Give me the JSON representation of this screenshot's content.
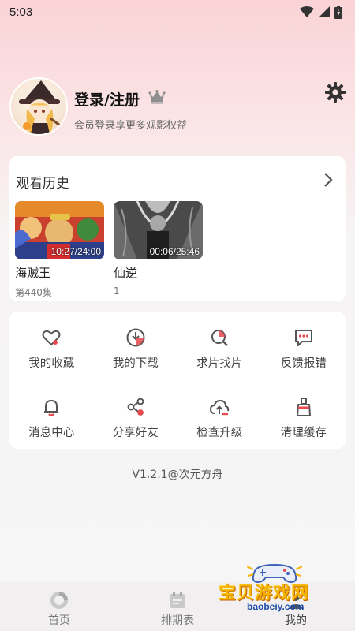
{
  "status_bar": {
    "time": "5:03"
  },
  "profile": {
    "username": "登录/注册",
    "subtitle": "会员登录享更多观影权益"
  },
  "history": {
    "title": "观看历史",
    "items": [
      {
        "name": "海贼王",
        "episode": "第440集",
        "time": "10:27/24:00"
      },
      {
        "name": "仙逆",
        "episode": "1",
        "time": "00:06/25:46"
      }
    ]
  },
  "menu": {
    "items": [
      {
        "label": "我的收藏",
        "icon": "heart-icon"
      },
      {
        "label": "我的下载",
        "icon": "download-icon"
      },
      {
        "label": "求片找片",
        "icon": "search-icon"
      },
      {
        "label": "反馈报错",
        "icon": "feedback-icon"
      },
      {
        "label": "消息中心",
        "icon": "bell-icon"
      },
      {
        "label": "分享好友",
        "icon": "share-icon"
      },
      {
        "label": "检查升级",
        "icon": "cloud-upload-icon"
      },
      {
        "label": "清理缓存",
        "icon": "broom-icon"
      }
    ]
  },
  "version": "V1.2.1@次元方舟",
  "bottom_nav": {
    "items": [
      {
        "label": "首页",
        "icon": "home-icon"
      },
      {
        "label": "排期表",
        "icon": "calendar-icon"
      },
      {
        "label": "我的",
        "icon": "profile-icon"
      }
    ]
  },
  "watermark": {
    "text": "宝贝游戏网",
    "url": "baobeiy.com"
  },
  "colors": {
    "accent": "#e5484d",
    "gradient_top": "#fad3d6"
  }
}
